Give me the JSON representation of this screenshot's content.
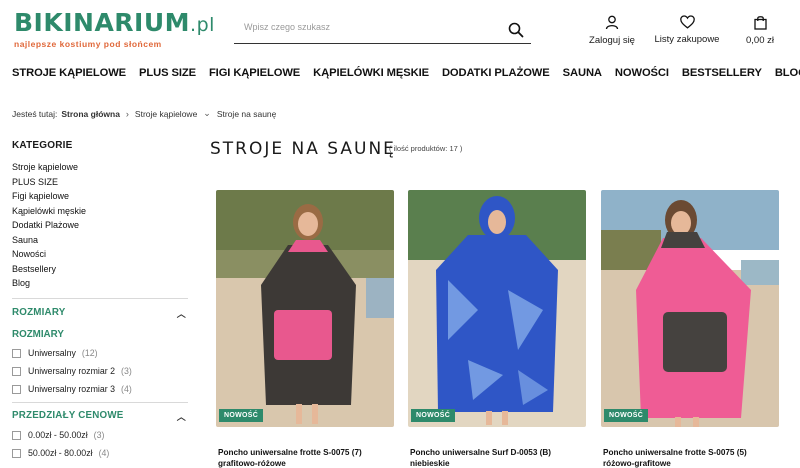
{
  "header": {
    "logo_main": "BIKINARIUM",
    "logo_suffix": ".pl",
    "logo_tagline": "najlepsze kostiumy pod słońcem",
    "search_placeholder": "Wpisz czego szukasz",
    "actions": [
      {
        "label": "Zaloguj się",
        "icon": "user-icon"
      },
      {
        "label": "Listy zakupowe",
        "icon": "heart-icon"
      },
      {
        "label": "0,00 zł",
        "icon": "shopping-bag-icon"
      }
    ]
  },
  "nav": {
    "items": [
      "STROJE KĄPIELOWE",
      "PLUS SIZE",
      "FIGI KĄPIELOWE",
      "KĄPIELÓWKI MĘSKIE",
      "DODATKI PLAŻOWE",
      "SAUNA",
      "NOWOŚCI",
      "BESTSELLERY",
      "BLOG"
    ]
  },
  "breadcrumb": {
    "prefix": "Jesteś tutaj:",
    "home": "Strona główna",
    "level1": "Stroje kąpielowe",
    "current": "Stroje na saunę"
  },
  "sidebar": {
    "categories_title": "KATEGORIE",
    "categories": [
      "Stroje kąpielowe",
      "PLUS SIZE",
      "Figi kąpielowe",
      "Kąpielówki męskie",
      "Dodatki Plażowe",
      "Sauna",
      "Nowości",
      "Bestsellery",
      "Blog"
    ],
    "sizes_title": "ROZMIARY",
    "sizes_subtitle": "ROZMIARY",
    "sizes": [
      {
        "label": "Uniwersalny",
        "count": "(12)"
      },
      {
        "label": "Uniwersalny rozmiar 2",
        "count": "(3)"
      },
      {
        "label": "Uniwersalny rozmiar 3",
        "count": "(4)"
      }
    ],
    "prices_title": "PRZEDZIAŁY CENOWE",
    "prices": [
      {
        "label": "0.00zł - 50.00zł",
        "count": "(3)"
      },
      {
        "label": "50.00zł - 80.00zł",
        "count": "(4)"
      }
    ]
  },
  "content": {
    "title": "STROJE NA SAUNĘ",
    "count": "( ilość produktów: 17 )"
  },
  "products": [
    {
      "badge": "NOWOŚĆ",
      "name": "Poncho uniwersalne frotte S-0075 (7) grafitowo-różowe",
      "colors": {
        "body": "#3d3936",
        "accent": "#e8588e",
        "bg_top": "#6d7a4a",
        "bg_bottom": "#d9c7ad"
      }
    },
    {
      "badge": "NOWOŚĆ",
      "name": "Poncho uniwersalne Surf D-0053 (B) niebieskie",
      "colors": {
        "body": "#2f56c6",
        "accent": "#8fb6ee",
        "bg_top": "#5a7f4e",
        "bg_bottom": "#e2d6c1"
      }
    },
    {
      "badge": "NOWOŚĆ",
      "name": "Poncho uniwersalne frotte S-0075 (5) różowo-grafitowe",
      "colors": {
        "body": "#ef5c95",
        "accent": "#45423f",
        "bg_top": "#8fb2c9",
        "bg_bottom": "#d8c6ad"
      }
    }
  ],
  "colors": {
    "brand_green": "#2e8a6b",
    "brand_orange": "#e0683a"
  }
}
